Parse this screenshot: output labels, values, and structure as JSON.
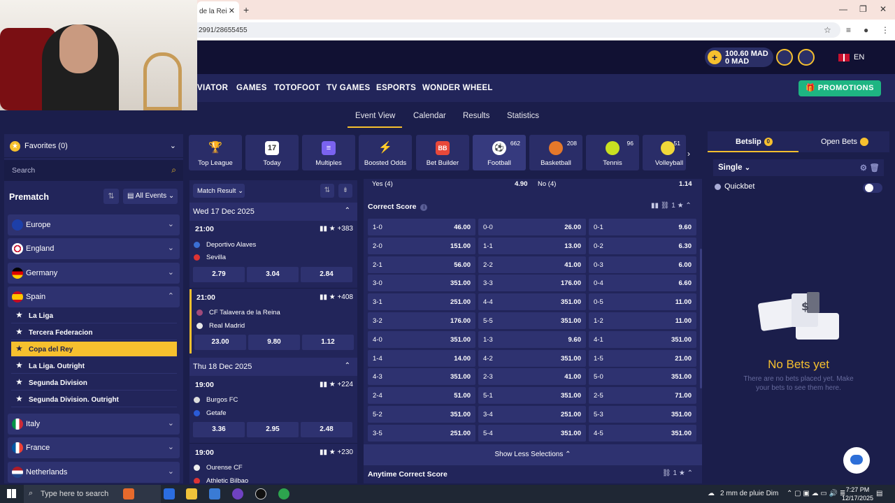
{
  "browser": {
    "tab_title": "de la Rei",
    "tab_close": "✕",
    "new_tab": "+",
    "url": "2991/28655455",
    "win_min": "—",
    "win_max": "❐",
    "win_close": "✕"
  },
  "header": {
    "balance_main": "100.60 MAD",
    "balance_bonus": "0 MAD",
    "language": "EN"
  },
  "nav": {
    "items": [
      "VIATOR",
      "GAMES",
      "TOTOFOOT",
      "TV GAMES",
      "ESPORTS",
      "WONDER WHEEL"
    ],
    "promotions": "PROMOTIONS"
  },
  "subnav": {
    "items": [
      "Event View",
      "Calendar",
      "Results",
      "Statistics"
    ],
    "active": "Event View"
  },
  "sidebar": {
    "favorites": "Favorites (0)",
    "search_placeholder": "Search",
    "section_title": "Prematch",
    "filter": "All Events",
    "countries": [
      {
        "name": "Europe",
        "expanded": false
      },
      {
        "name": "England",
        "expanded": false
      },
      {
        "name": "Germany",
        "expanded": false
      },
      {
        "name": "Spain",
        "expanded": true
      },
      {
        "name": "Italy",
        "expanded": false
      },
      {
        "name": "France",
        "expanded": false
      },
      {
        "name": "Netherlands",
        "expanded": false
      }
    ],
    "spain_leagues": [
      "La Liga",
      "Tercera Federacion",
      "Copa del Rey",
      "La Liga. Outright",
      "Segunda Division",
      "Segunda Division. Outright"
    ],
    "active_league": "Copa del Rey"
  },
  "categories": [
    {
      "label": "Top League",
      "count": ""
    },
    {
      "label": "Today",
      "count": ""
    },
    {
      "label": "Multiples",
      "count": ""
    },
    {
      "label": "Boosted Odds",
      "count": ""
    },
    {
      "label": "Bet Builder",
      "count": ""
    },
    {
      "label": "Football",
      "count": "662"
    },
    {
      "label": "Basketball",
      "count": "208"
    },
    {
      "label": "Tennis",
      "count": "96"
    },
    {
      "label": "Volleyball",
      "count": "51"
    }
  ],
  "today_icon_text": "17",
  "betbuilder_icon_text": "BB",
  "matches": {
    "market_selector": "Match Result",
    "days": [
      "Wed 17 Dec 2025",
      "Thu 18 Dec 2025"
    ],
    "list": [
      {
        "time": "21:00",
        "extra": "+383",
        "home": "Deportivo Alaves",
        "away": "Sevilla",
        "odds": [
          "2.79",
          "3.04",
          "2.84"
        ]
      },
      {
        "time": "21:00",
        "extra": "+408",
        "home": "CF Talavera de la Reina",
        "away": "Real Madrid",
        "odds": [
          "23.00",
          "9.80",
          "1.12"
        ]
      },
      {
        "time": "19:00",
        "extra": "+224",
        "home": "Burgos FC",
        "away": "Getafe",
        "odds": [
          "3.36",
          "2.95",
          "2.48"
        ]
      },
      {
        "time": "19:00",
        "extra": "+230",
        "home": "Ourense CF",
        "away": "Athletic Bilbao",
        "odds": []
      }
    ]
  },
  "markets": {
    "prev_row": {
      "left_label": "Yes (4)",
      "left_value": "4.90",
      "right_label": "No (4)",
      "right_value": "1.14"
    },
    "correct_score_title": "Correct Score",
    "correct_score_link_count": "1",
    "correct_score": [
      [
        [
          "1-0",
          "46.00"
        ],
        [
          "0-0",
          "26.00"
        ],
        [
          "0-1",
          "9.60"
        ]
      ],
      [
        [
          "2-0",
          "151.00"
        ],
        [
          "1-1",
          "13.00"
        ],
        [
          "0-2",
          "6.30"
        ]
      ],
      [
        [
          "2-1",
          "56.00"
        ],
        [
          "2-2",
          "41.00"
        ],
        [
          "0-3",
          "6.00"
        ]
      ],
      [
        [
          "3-0",
          "351.00"
        ],
        [
          "3-3",
          "176.00"
        ],
        [
          "0-4",
          "6.60"
        ]
      ],
      [
        [
          "3-1",
          "251.00"
        ],
        [
          "4-4",
          "351.00"
        ],
        [
          "0-5",
          "11.00"
        ]
      ],
      [
        [
          "3-2",
          "176.00"
        ],
        [
          "5-5",
          "351.00"
        ],
        [
          "1-2",
          "11.00"
        ]
      ],
      [
        [
          "4-0",
          "351.00"
        ],
        [
          "1-3",
          "9.60"
        ],
        [
          "4-1",
          "351.00"
        ]
      ],
      [
        [
          "1-4",
          "14.00"
        ],
        [
          "4-2",
          "351.00"
        ],
        [
          "1-5",
          "21.00"
        ]
      ],
      [
        [
          "4-3",
          "351.00"
        ],
        [
          "2-3",
          "41.00"
        ],
        [
          "5-0",
          "351.00"
        ]
      ],
      [
        [
          "2-4",
          "51.00"
        ],
        [
          "5-1",
          "351.00"
        ],
        [
          "2-5",
          "71.00"
        ]
      ],
      [
        [
          "5-2",
          "351.00"
        ],
        [
          "3-4",
          "251.00"
        ],
        [
          "5-3",
          "351.00"
        ]
      ],
      [
        [
          "3-5",
          "251.00"
        ],
        [
          "5-4",
          "351.00"
        ],
        [
          "4-5",
          "351.00"
        ]
      ]
    ],
    "show_less": "Show Less Selections",
    "anytime_title": "Anytime Correct Score",
    "anytime_link_count": "1"
  },
  "betslip": {
    "tab_betslip": "Betslip",
    "betslip_count": "0",
    "tab_open": "Open Bets",
    "mode": "Single",
    "quickbet": "Quickbet",
    "quickbet_on": false,
    "no_bets_title": "No Bets yet",
    "no_bets_text": "There are no bets placed yet. Make your bets to see them here."
  },
  "taskbar": {
    "search_placeholder": "Type here to search",
    "weather": "2 mm de pluie Dim",
    "time": "7:27 PM",
    "date": "12/17/2025"
  },
  "colors": {
    "accent": "#f6c02e",
    "bg": "#1b1e4b",
    "panel": "#22255a",
    "promo": "#1eb582"
  }
}
